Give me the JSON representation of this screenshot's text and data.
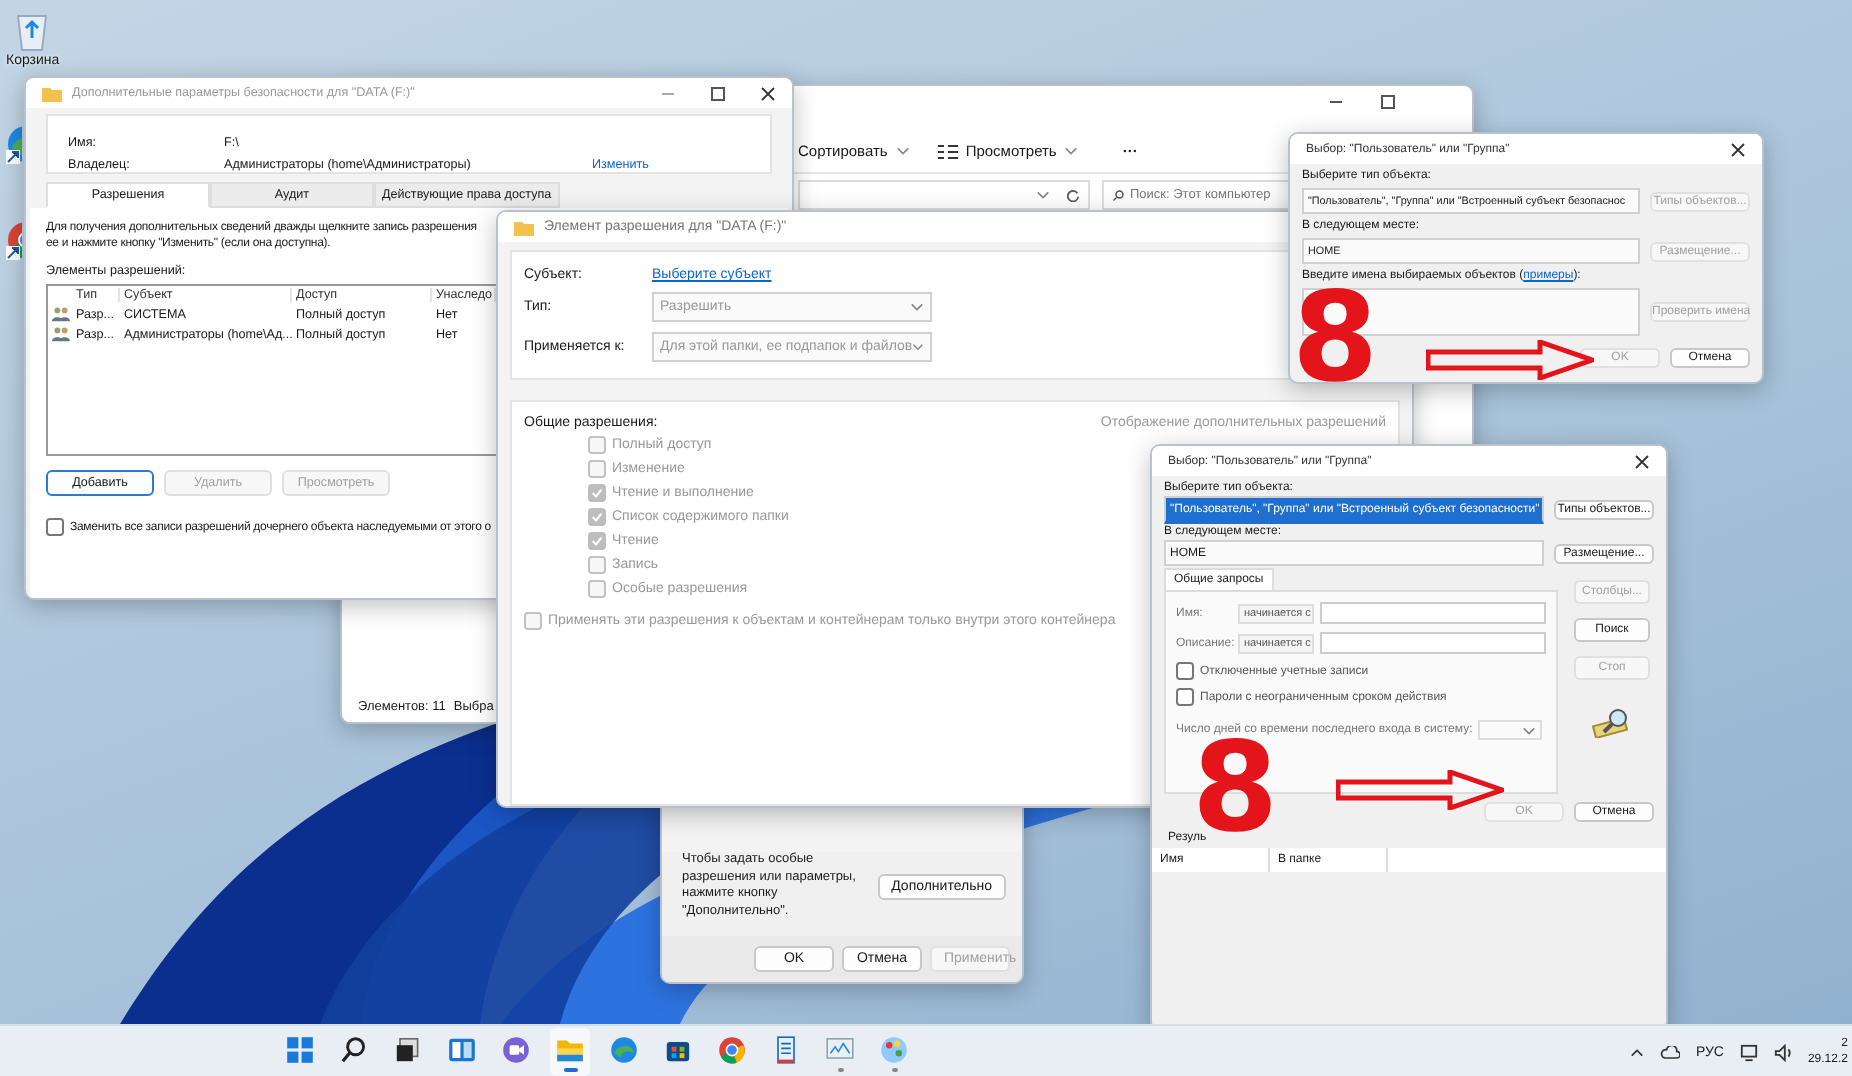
{
  "desktop_icons": [
    {
      "kind": "recycle_bin",
      "label": "Корзина"
    },
    {
      "kind": "edge_shortcut"
    },
    {
      "kind": "chrome_shortcut"
    }
  ],
  "explorer": {
    "toolbar": [
      {
        "kind": "sort",
        "label": "Сортировать"
      },
      {
        "kind": "view",
        "label": "Просмотреть"
      },
      {
        "kind": "more",
        "label": "···"
      }
    ],
    "search": {
      "placeholder": "Поиск: Этот компьютер"
    },
    "status_bar": [
      "Элементов: 11",
      "Выбра"
    ]
  },
  "properties": {
    "hint": "Чтобы задать особые разрешения или параметры, нажмите кнопку \"Дополнительно\".",
    "advanced_button": "Дополнительно",
    "buttons": [
      {
        "label": "OK",
        "disabled": false
      },
      {
        "label": "Отмена",
        "disabled": false
      },
      {
        "label": "Применить",
        "disabled": true
      }
    ]
  },
  "security": {
    "title": "Дополнительные параметры безопасности  для \"DATA (F:)\"",
    "name_label": "Имя:",
    "name_value": "F:\\",
    "owner_label": "Владелец:",
    "owner_value": "Администраторы (home\\Администраторы)",
    "owner_link": "Изменить",
    "tabs": [
      {
        "label": "Разрешения",
        "selected": true
      },
      {
        "label": "Аудит",
        "selected": false
      },
      {
        "label": "Действующие права доступа",
        "selected": false
      }
    ],
    "info_lines": [
      "Для получения дополнительных сведений дважды щелкните запись разрешения",
      "ее и нажмите кнопку \"Изменить\" (если она доступна)."
    ],
    "list_label": "Элементы разрешений:",
    "columns": [
      "Тип",
      "Субъект",
      "Доступ",
      "Унаследо"
    ],
    "rows": [
      {
        "type": "Разр...",
        "subject": "СИСТЕМА",
        "access": "Полный доступ",
        "inherited": "Нет"
      },
      {
        "type": "Разр...",
        "subject": "Администраторы (home\\Ад...",
        "access": "Полный доступ",
        "inherited": "Нет"
      }
    ],
    "buttons": [
      {
        "label": "Добавить",
        "disabled": false
      },
      {
        "label": "Удалить",
        "disabled": true
      },
      {
        "label": "Просмотреть",
        "disabled": true
      }
    ],
    "replace_checkbox": {
      "label": "Заменить все записи разрешений дочернего объекта наследуемыми от этого о",
      "checked": false
    }
  },
  "permission_entry": {
    "title": "Элемент разрешения для \"DATA (F:)\"",
    "subject_label": "Субъект:",
    "subject_link": "Выберите субъект",
    "type_label": "Тип:",
    "type_value": "Разрешить",
    "applies_label": "Применяется к:",
    "applies_value": "Для этой папки, ее подпапок и файлов",
    "section_label": "Общие разрешения:",
    "show_more_link": "Отображение дополнительных разрешений",
    "permissions": [
      {
        "label": "Полный доступ",
        "checked": false,
        "disabled": true
      },
      {
        "label": "Изменение",
        "checked": false,
        "disabled": true
      },
      {
        "label": "Чтение и выполнение",
        "checked": true,
        "disabled": true
      },
      {
        "label": "Список содержимого папки",
        "checked": true,
        "disabled": true
      },
      {
        "label": "Чтение",
        "checked": true,
        "disabled": true
      },
      {
        "label": "Запись",
        "checked": false,
        "disabled": true
      },
      {
        "label": "Особые разрешения",
        "checked": false,
        "disabled": true
      }
    ],
    "inherit_checkbox": {
      "label": "Применять эти разрешения к объектам и контейнерам только внутри этого контейнера",
      "checked": false
    }
  },
  "select_small": {
    "title": "Выбор: \"Пользователь\" или \"Группа\"",
    "object_type_label": "Выберите тип объекта:",
    "object_type_value": "\"Пользователь\", \"Группа\" или \"Встроенный субъект безопаснос",
    "object_type_selected": false,
    "object_types_button": {
      "label": "Типы объектов...",
      "disabled": true
    },
    "location_label": "В следующем месте:",
    "location_value": "HOME",
    "location_button": {
      "label": "Размещение...",
      "disabled": true
    },
    "names_label": "Введите имена выбираемых объектов (",
    "names_link": "примеры",
    "names_label_end": "):",
    "check_button": {
      "label": "Проверить имена",
      "disabled": true
    },
    "ok_button": {
      "label": "OK",
      "disabled": true
    },
    "cancel_button": {
      "label": "Отмена",
      "disabled": false
    },
    "annotation": "8"
  },
  "select_large": {
    "title": "Выбор: \"Пользователь\" или \"Группа\"",
    "object_type_label": "Выберите тип объекта:",
    "object_type_value": "\"Пользователь\", \"Группа\" или \"Встроенный субъект безопасности\"",
    "object_type_selected": true,
    "object_types_button": {
      "label": "Типы объектов...",
      "disabled": false
    },
    "location_label": "В следующем месте:",
    "location_value": "HOME",
    "location_button": {
      "label": "Размещение...",
      "disabled": false
    },
    "query_tab": "Общие запросы",
    "name_label": "Имя:",
    "name_op": "начинается с",
    "description_label": "Описание:",
    "description_op": "начинается с",
    "query_checkboxes": [
      {
        "label": "Отключенные учетные записи",
        "checked": false
      },
      {
        "label": "Пароли с неограниченным сроком действия",
        "checked": false
      }
    ],
    "days_label": "Число дней со времени последнего входа в систему:",
    "side_buttons": [
      {
        "label": "Столбцы...",
        "disabled": true
      },
      {
        "label": "Поиск",
        "disabled": false
      },
      {
        "label": "Стоп",
        "disabled": true
      }
    ],
    "ok_button": {
      "label": "OK",
      "disabled": true
    },
    "cancel_button": {
      "label": "Отмена",
      "disabled": false
    },
    "results_label": "Резуль",
    "result_columns": [
      "Имя",
      "В папке"
    ],
    "annotation": "8"
  },
  "taskbar": {
    "apps": [
      {
        "kind": "start",
        "open": false,
        "focused": false
      },
      {
        "kind": "search",
        "open": false,
        "focused": false
      },
      {
        "kind": "task_view",
        "open": false,
        "focused": false
      },
      {
        "kind": "widgets",
        "open": false,
        "focused": false
      },
      {
        "kind": "chat",
        "open": false,
        "focused": false
      },
      {
        "kind": "folder",
        "open": true,
        "focused": true
      },
      {
        "kind": "edge",
        "open": false,
        "focused": false
      },
      {
        "kind": "store",
        "open": false,
        "focused": false
      },
      {
        "kind": "chrome",
        "open": false,
        "focused": false
      },
      {
        "kind": "notepad",
        "open": false,
        "focused": false
      },
      {
        "kind": "monitor",
        "open": true,
        "focused": false
      },
      {
        "kind": "paint",
        "open": true,
        "focused": false
      }
    ],
    "language": "РУС",
    "time": "2",
    "date": "29.12.2"
  }
}
